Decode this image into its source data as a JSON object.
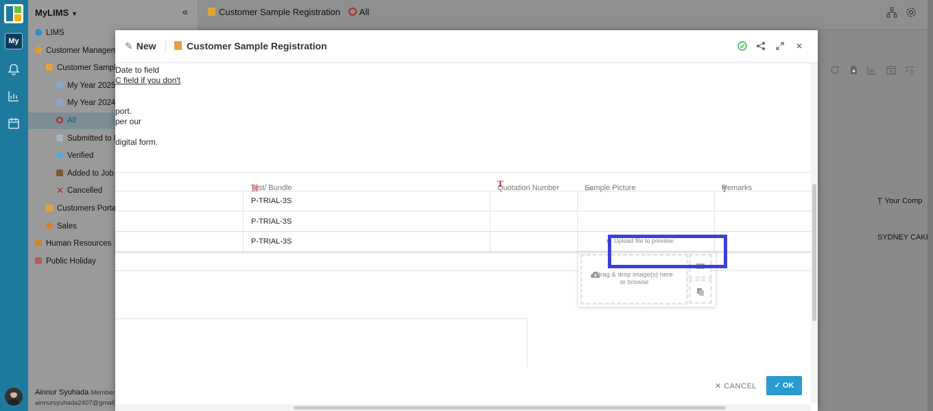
{
  "app": {
    "name": "MyLIMS",
    "rail_badge": "My"
  },
  "sidebar": {
    "items": [
      {
        "label": "LIMS",
        "icon": "globe-icon"
      },
      {
        "label": "Customer Managem",
        "icon": "customer-icon"
      },
      {
        "label": "Customer Sampl",
        "icon": "scroll-icon"
      },
      {
        "label": "My Year 2025",
        "icon": "chart-icon"
      },
      {
        "label": "My Year 2024",
        "icon": "chart-icon"
      },
      {
        "label": "All",
        "icon": "circle-icon"
      },
      {
        "label": "Submitted to L",
        "icon": "document-icon"
      },
      {
        "label": "Verified",
        "icon": "diamond-icon"
      },
      {
        "label": "Added to Job",
        "icon": "upload-tray-icon"
      },
      {
        "label": "Cancelled",
        "icon": "x-icon"
      },
      {
        "label": "Customers Porta",
        "icon": "portal-icon"
      },
      {
        "label": "Sales",
        "icon": "sales-icon"
      },
      {
        "label": "Human Resources",
        "icon": "hr-icon"
      },
      {
        "label": "Public Holiday",
        "icon": "calendar-icon"
      }
    ],
    "user_name": "Ainnur Syuhada",
    "user_role": "Member",
    "user_email": "ainnursyuhada2407@gmail"
  },
  "topbar": {
    "title": "Customer Sample Registration",
    "view": "All"
  },
  "background": {
    "col_header": "Your Comp",
    "cell_value": "SYDNEY CAKE"
  },
  "modal": {
    "mode": "New",
    "title": "Customer Sample Registration",
    "text_lines": [
      "Date to field",
      "C field if you don't",
      "port.",
      "per our",
      "digital form."
    ],
    "columns": {
      "test_bundle": "Test/ Bundle",
      "quotation_number": "Quotation Number",
      "sample_picture": "Sample Picture",
      "remarks": "Remarks"
    },
    "rows": [
      {
        "test_bundle": "P-TRIAL-3S"
      },
      {
        "test_bundle": "P-TRIAL-3S"
      },
      {
        "test_bundle": "P-TRIAL-3S"
      }
    ],
    "clear_glyph": "×",
    "upload": {
      "hint": "Upload file to preview.",
      "drop_line1": "Drag & drop image(s) here",
      "drop_line2": "or browse"
    },
    "cancel_label": "CANCEL",
    "ok_label": "OK"
  },
  "colors": {
    "accent": "#2a9bd1",
    "rail": "#1e7a9c",
    "highlight": "#3a41d8"
  }
}
